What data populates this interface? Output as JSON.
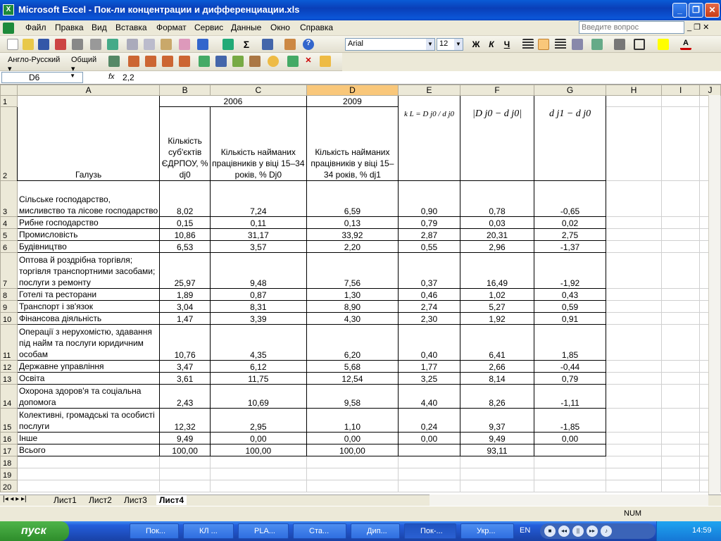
{
  "window": {
    "title": "Microsoft Excel - Пок-ли концентрации и дифференциации.xls"
  },
  "menu": [
    "Файл",
    "Правка",
    "Вид",
    "Вставка",
    "Формат",
    "Сервис",
    "Данные",
    "Окно",
    "Справка"
  ],
  "ask_placeholder": "Введите вопрос",
  "font": {
    "name": "Arial",
    "size": "12"
  },
  "format_buttons": [
    "Ж",
    "К",
    "Ч"
  ],
  "toolbar3": {
    "lang": "Англо-Русский",
    "mode": "Общий"
  },
  "formula": {
    "cell": "D6",
    "fx": "fx",
    "value": "2,2"
  },
  "columns": [
    "A",
    "B",
    "C",
    "D",
    "E",
    "F",
    "G",
    "H",
    "I",
    "J"
  ],
  "header": {
    "b2006": "2006",
    "d2009": "2009",
    "galuz": "Галузь",
    "b": "Кількість суб'єктів ЄДРПОУ, % dj0",
    "c": "Кількість найманих працівників у віці 15–34 років, % Dj0",
    "d": "Кількість найманих працівників у віці 15–34 років, % dj1",
    "e": "k L = D j0 / d j0",
    "f": "|D j0 − d j0|",
    "g": "d j1 − d j0"
  },
  "rows": [
    [
      "3",
      "Сільське господарство, мисливство та лісове господарство",
      "8,02",
      "7,24",
      "6,59",
      "0,90",
      "0,78",
      "-0,65"
    ],
    [
      "4",
      "Рибне господарство",
      "0,15",
      "0,11",
      "0,13",
      "0,79",
      "0,03",
      "0,02"
    ],
    [
      "5",
      "Промисловість",
      "10,86",
      "31,17",
      "33,92",
      "2,87",
      "20,31",
      "2,75"
    ],
    [
      "6",
      "Будівництво",
      "6,53",
      "3,57",
      "2,20",
      "0,55",
      "2,96",
      "-1,37"
    ],
    [
      "7",
      "Оптова й роздрібна торгівля; торгівля транспортними засобами; послуги з ремонту",
      "25,97",
      "9,48",
      "7,56",
      "0,37",
      "16,49",
      "-1,92"
    ],
    [
      "8",
      "Готелі та ресторани",
      "1,89",
      "0,87",
      "1,30",
      "0,46",
      "1,02",
      "0,43"
    ],
    [
      "9",
      "Транспорт і зв'язок",
      "3,04",
      "8,31",
      "8,90",
      "2,74",
      "5,27",
      "0,59"
    ],
    [
      "10",
      "Фінансова діяльність",
      "1,47",
      "3,39",
      "4,30",
      "2,30",
      "1,92",
      "0,91"
    ],
    [
      "11",
      "Операції з нерухомістю, здавання під найм та послуги юридичним особам",
      "10,76",
      "4,35",
      "6,20",
      "0,40",
      "6,41",
      "1,85"
    ],
    [
      "12",
      "Державне управління",
      "3,47",
      "6,12",
      "5,68",
      "1,77",
      "2,66",
      "-0,44"
    ],
    [
      "13",
      "Освіта",
      "3,61",
      "11,75",
      "12,54",
      "3,25",
      "8,14",
      "0,79"
    ],
    [
      "14",
      "Охорона здоров'я та соціальна допомога",
      "2,43",
      "10,69",
      "9,58",
      "4,40",
      "8,26",
      "-1,11"
    ],
    [
      "15",
      "Колективні, громадські та особисті послуги",
      "12,32",
      "2,95",
      "1,10",
      "0,24",
      "9,37",
      "-1,85"
    ],
    [
      "16",
      "Інше",
      "9,49",
      "0,00",
      "0,00",
      "0,00",
      "9,49",
      "0,00"
    ],
    [
      "17",
      "Всього",
      "100,00",
      "100,00",
      "100,00",
      "",
      "93,11",
      ""
    ]
  ],
  "sheets": [
    "Лист1",
    "Лист2",
    "Лист3",
    "Лист4"
  ],
  "status": {
    "num": "NUM"
  },
  "taskbar": {
    "start": "пуск",
    "tasks": [
      "Пок...",
      "КЛ ...",
      "PLA...",
      "Ста...",
      "Дип...",
      "Пок-...",
      "Укр..."
    ],
    "lang": "EN",
    "time": "14:59"
  }
}
